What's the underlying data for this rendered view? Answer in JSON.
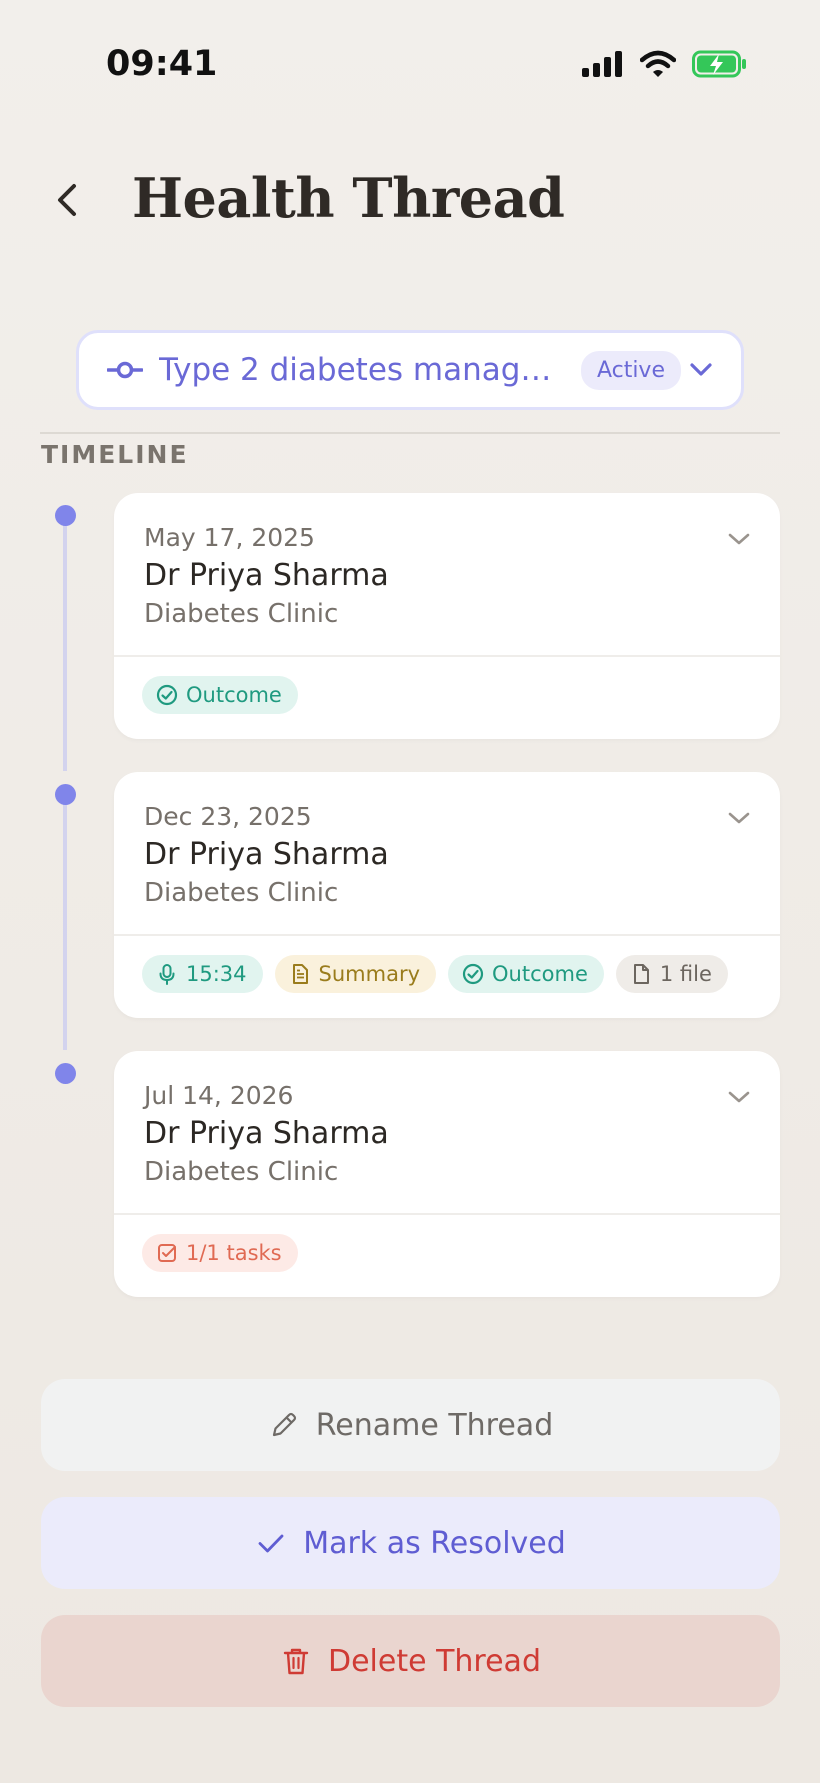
{
  "status_bar": {
    "time": "09:41"
  },
  "header": {
    "title": "Health Thread"
  },
  "thread_selector": {
    "name": "Type 2 diabetes manage…",
    "status": "Active"
  },
  "timeline": {
    "label": "TIMELINE",
    "visits": [
      {
        "date": "May 17, 2025",
        "doctor": "Dr Priya Sharma",
        "clinic": "Diabetes Clinic",
        "chips": [
          {
            "type": "outcome",
            "label": "Outcome"
          }
        ]
      },
      {
        "date": "Dec 23, 2025",
        "doctor": "Dr Priya Sharma",
        "clinic": "Diabetes Clinic",
        "chips": [
          {
            "type": "audio",
            "label": "15:34"
          },
          {
            "type": "summary",
            "label": "Summary"
          },
          {
            "type": "outcome",
            "label": "Outcome"
          },
          {
            "type": "file",
            "label": "1 file"
          }
        ]
      },
      {
        "date": "Jul 14, 2026",
        "doctor": "Dr Priya Sharma",
        "clinic": "Diabetes Clinic",
        "chips": [
          {
            "type": "tasks",
            "label": "1/1 tasks"
          }
        ]
      }
    ]
  },
  "actions": {
    "rename": "Rename Thread",
    "resolve": "Mark as Resolved",
    "delete": "Delete Thread"
  },
  "colors": {
    "accent": "#6a69d6",
    "timeline_dot": "#8085ea",
    "success": "#1f9a80",
    "danger": "#cf3b34"
  }
}
